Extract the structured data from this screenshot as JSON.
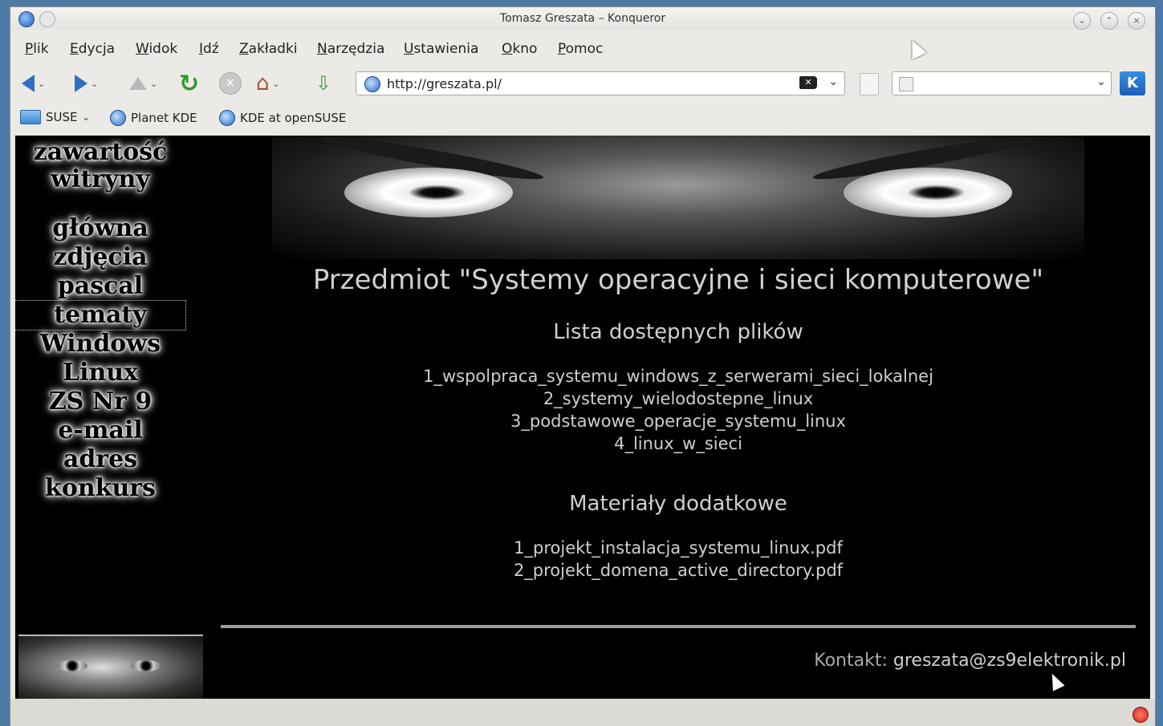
{
  "window": {
    "title": "Tomasz Greszata – Konqueror"
  },
  "menubar": {
    "items": [
      "Plik",
      "Edycja",
      "Widok",
      "Idź",
      "Zakładki",
      "Narzędzia",
      "Ustawienia",
      "Okno",
      "Pomoc"
    ]
  },
  "toolbar": {
    "url": "http://greszata.pl/",
    "search_value": ""
  },
  "bookmarks": {
    "items": [
      "SUSE",
      "Planet KDE",
      "KDE at openSUSE"
    ]
  },
  "sidebar": {
    "heading_line1": "zawartość",
    "heading_line2": "witryny",
    "items": [
      "główna",
      "zdjęcia",
      "pascal",
      "tematy",
      "Windows",
      "Linux",
      "ZS Nr 9",
      "e-mail",
      "adres",
      "konkurs"
    ]
  },
  "content": {
    "main_title": "Przedmiot \"Systemy operacyjne i sieci komputerowe\"",
    "files_heading": "Lista dostępnych plików",
    "files": [
      "1_wspolpraca_systemu_windows_z_serwerami_sieci_lokalnej",
      "2_systemy_wielodostepne_linux",
      "3_podstawowe_operacje_systemu_linux",
      "4_linux_w_sieci"
    ],
    "extra_heading": "Materiały dodatkowe",
    "extra_files": [
      "1_projekt_instalacja_systemu_linux.pdf",
      "2_projekt_domena_active_directory.pdf"
    ],
    "contact_label": "Kontakt:",
    "contact_email": "greszata@zs9elektronik.pl"
  },
  "colors": {
    "page_background": "#000000",
    "accent": "#2f6fc7",
    "text": "#cfcfcf"
  }
}
